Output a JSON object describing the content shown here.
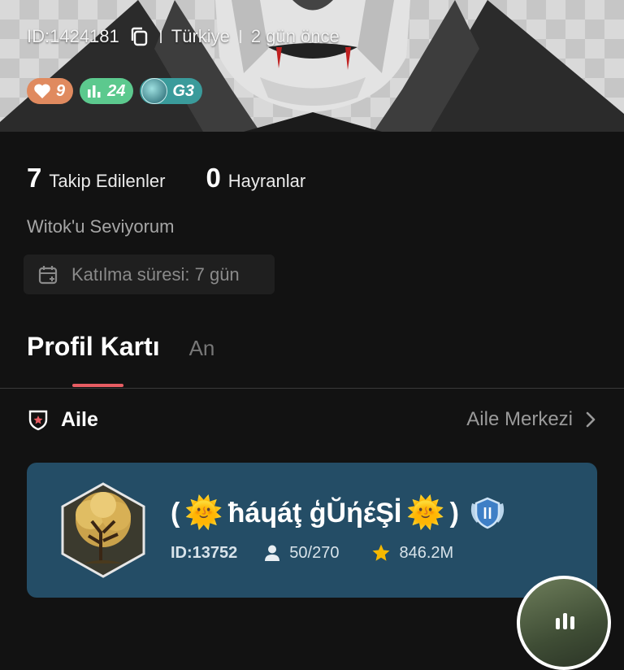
{
  "profile": {
    "id_label": "ID:1424181",
    "country": "Türkiye",
    "last_seen": "2 gün önce",
    "badges": {
      "likes": "9",
      "level": "24",
      "guard": "G3"
    },
    "following": {
      "count": "7",
      "label": "Takip Edilenler"
    },
    "followers": {
      "count": "0",
      "label": "Hayranlar"
    },
    "bio": "Witok'u Seviyorum",
    "join_duration": "Katılma süresi: 7 gün"
  },
  "tabs": [
    {
      "label": "Profil Kartı",
      "active": true
    },
    {
      "label": "An",
      "active": false
    }
  ],
  "family": {
    "section_title": "Aile",
    "center_link": "Aile Merkezi",
    "card": {
      "name_open": "(",
      "name_text": "ħáɥáţ ģŬήέŞİ",
      "name_close": ")",
      "sun_glyph": "🌞",
      "id": "ID:13752",
      "members": "50/270",
      "points": "846.2M"
    }
  },
  "colors": {
    "background": "#121212",
    "tab_indicator": "#e85d63",
    "family_card": "#244d66",
    "badge_likes": "#e08a5f",
    "badge_level": "#5cc98e",
    "badge_guard": "#3a9b9b",
    "star": "#f5b800"
  },
  "icons": [
    "copy-icon",
    "heart-icon",
    "bar-chart-icon",
    "calendar-icon",
    "shield-icon",
    "chevron-right-icon",
    "person-icon",
    "star-icon",
    "rank-emblem-icon"
  ]
}
